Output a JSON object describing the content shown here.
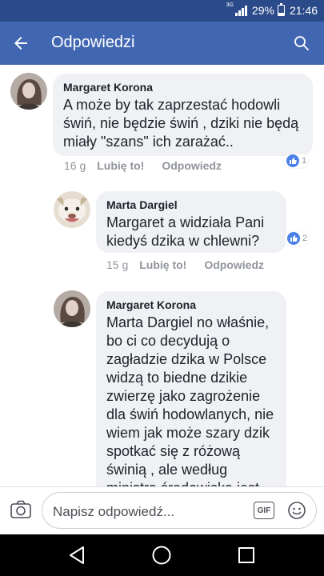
{
  "status_bar": {
    "network": "3G",
    "battery_percent": "29%",
    "battery_level": 0.29,
    "time": "21:46"
  },
  "app_bar": {
    "title": "Odpowiedzi"
  },
  "comments": [
    {
      "author": "Margaret Korona",
      "text": "A może by tak zaprzestać hodowli świń, nie będzie świń , dziki nie będą miały \"szans\" ich zarażać..",
      "time": "16 g",
      "like_label": "Lubię to!",
      "reply_label": "Odpowiedz",
      "reactions": "1"
    },
    {
      "author": "Marta Dargiel",
      "text": "Margaret a widziała Pani kiedyś dzika w chlewni?",
      "time": "15 g",
      "like_label": "Lubię to!",
      "reply_label": "Odpowiedz",
      "reactions": "2"
    },
    {
      "author": "Margaret Korona",
      "text": "Marta Dargiel no właśnie, bo ci co decydują o zagładzie dzika w Polsce widzą to biedne dzikie zwierzę jako zagrożenie dla świń hodowlanych, nie wiem jak może szary dzik spotkać się z różową świnią , ale według ministra środowiska jest"
    }
  ],
  "composer": {
    "placeholder": "Napisz odpowiedź...",
    "gif_label": "GIF"
  },
  "colors": {
    "status_bar": "#2b4a8a",
    "app_bar": "#4267b2",
    "bubble": "#f0f1f4",
    "like_blue": "#4b80e8",
    "meta_gray": "#90949c"
  }
}
